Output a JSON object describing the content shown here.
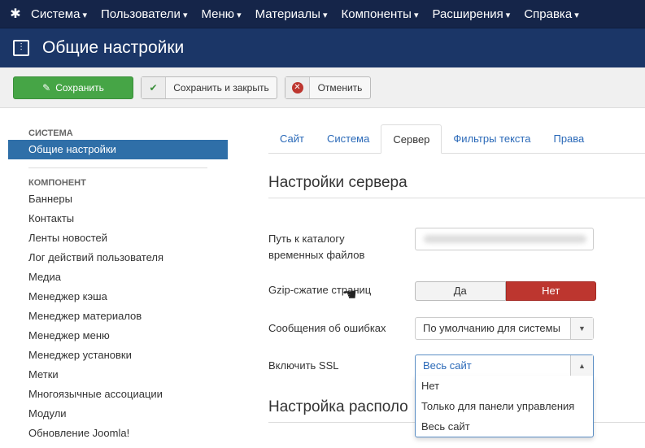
{
  "nav": {
    "items": [
      "Система",
      "Пользователи",
      "Меню",
      "Материалы",
      "Компоненты",
      "Расширения",
      "Справка"
    ]
  },
  "header": {
    "title": "Общие настройки"
  },
  "toolbar": {
    "save": "Сохранить",
    "save_close": "Сохранить и закрыть",
    "cancel": "Отменить"
  },
  "sidebar": {
    "section1": "СИСТЕМА",
    "active": "Общие настройки",
    "section2": "КОМПОНЕНТ",
    "items": [
      "Баннеры",
      "Контакты",
      "Ленты новостей",
      "Лог действий пользователя",
      "Медиа",
      "Менеджер кэша",
      "Менеджер материалов",
      "Менеджер меню",
      "Менеджер установки",
      "Метки",
      "Многоязычные ассоциации",
      "Модули",
      "Обновление Joomla!"
    ]
  },
  "tabs": [
    "Сайт",
    "Система",
    "Сервер",
    "Фильтры текста",
    "Права"
  ],
  "main": {
    "heading": "Настройки сервера",
    "heading2": "Настройка располо",
    "tmp_label": "Путь к каталогу временных файлов",
    "tmp_value": "",
    "gzip_label": "Gzip-сжатие страниц",
    "gzip_yes": "Да",
    "gzip_no": "Нет",
    "gzip_value": "Нет",
    "errors_label": "Сообщения об ошибках",
    "errors_value": "По умолчанию для системы",
    "ssl_label": "Включить SSL",
    "ssl_value": "Весь сайт",
    "ssl_options": [
      "Нет",
      "Только для панели управления",
      "Весь сайт"
    ]
  },
  "colors": {
    "nav": "#152549",
    "header": "#1b3667",
    "save": "#46a546",
    "active": "#2f6fa8",
    "no": "#bd362f"
  }
}
